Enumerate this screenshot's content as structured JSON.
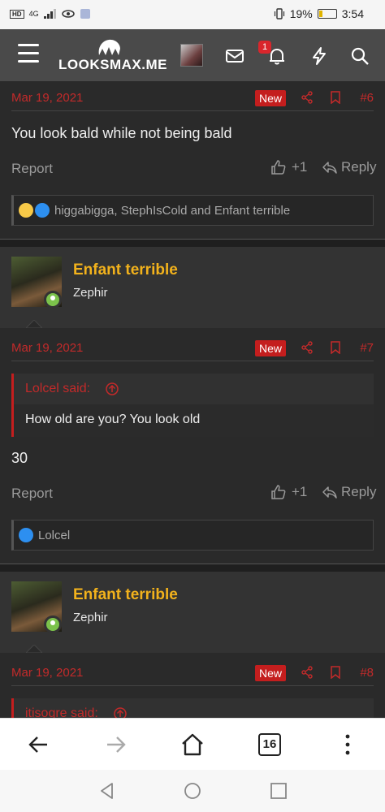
{
  "status_bar": {
    "left_indicator": "4G",
    "battery_percent": "19%",
    "battery_level": 0.19,
    "time": "3:54"
  },
  "header": {
    "logo_text": "LOOKSMAX.ME",
    "notification_count": "1"
  },
  "posts": [
    {
      "date": "Mar 19, 2021",
      "badge": "New",
      "number": "#6",
      "text": "You look bald while not being bald",
      "report": "Report",
      "likes": "+1",
      "reply": "Reply",
      "reactions": "higgabigga, StephIsCold and Enfant terrible"
    },
    {
      "author": "Enfant terrible",
      "author_title": "Zephir",
      "date": "Mar 19, 2021",
      "badge": "New",
      "number": "#7",
      "quote_author": "Lolcel said:",
      "quote_text": "How old are you? You look old",
      "text": "30",
      "report": "Report",
      "likes": "+1",
      "reply": "Reply",
      "reactions": "Lolcel"
    },
    {
      "author": "Enfant terrible",
      "author_title": "Zephir",
      "date": "Mar 19, 2021",
      "badge": "New",
      "number": "#8",
      "quote_author": "itisogre said:"
    }
  ],
  "browser": {
    "tab_count": "16"
  }
}
